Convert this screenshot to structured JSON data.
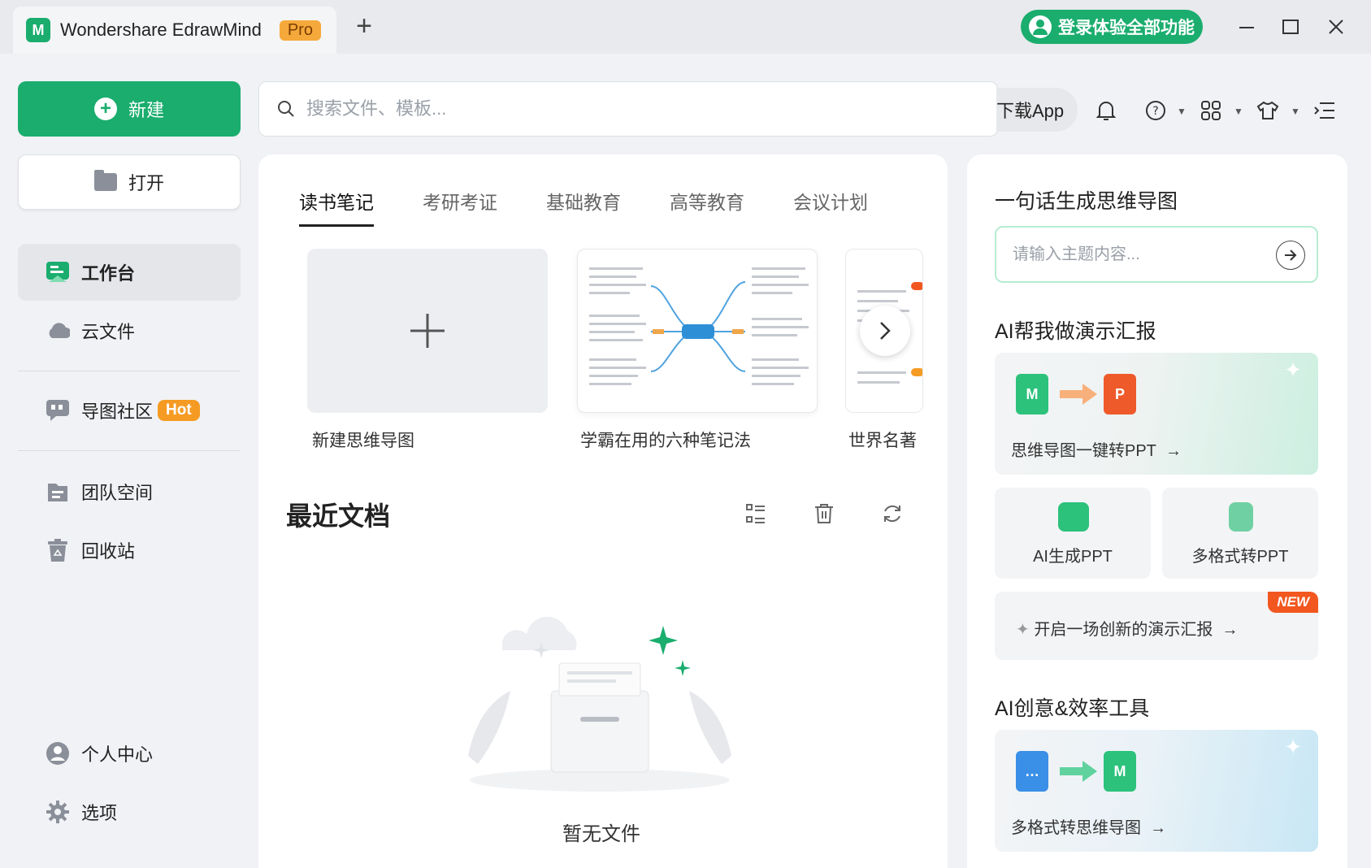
{
  "window": {
    "tab_title": "Wondershare EdrawMind",
    "pro_badge": "Pro",
    "new_tab": "+",
    "login_label": "登录体验全部功能",
    "minimize": "—",
    "maximize": "☐",
    "close": "✕"
  },
  "sidebar": {
    "new_label": "新建",
    "open_label": "打开",
    "nav": [
      {
        "label": "工作台"
      },
      {
        "label": "云文件"
      },
      {
        "label": "导图社区",
        "badge": "Hot"
      },
      {
        "label": "团队空间"
      },
      {
        "label": "回收站"
      }
    ],
    "bottom": [
      {
        "label": "个人中心"
      },
      {
        "label": "选项"
      }
    ]
  },
  "search": {
    "placeholder": "搜索文件、模板..."
  },
  "toolbar": {
    "download_app": "下载App"
  },
  "templates": {
    "tabs": [
      "读书笔记",
      "考研考证",
      "基础教育",
      "高等教育",
      "会议计划"
    ],
    "active_tab": "读书笔记",
    "cards": [
      {
        "label": "新建思维导图"
      },
      {
        "label": "学霸在用的六种笔记法"
      },
      {
        "label": "世界名著"
      }
    ]
  },
  "recent": {
    "title": "最近文档",
    "empty_text": "暂无文件"
  },
  "right_panel": {
    "ai_title": "一句话生成思维导图",
    "ai_placeholder": "请输入主题内容...",
    "present_title": "AI帮我做演示汇报",
    "mind_to_ppt": "思维导图一键转PPT",
    "ai_ppt": "AI生成PPT",
    "multi_ppt": "多格式转PPT",
    "promo_text": "开启一场创新的演示汇报",
    "new_badge": "NEW",
    "tools_title": "AI创意&效率工具",
    "multi_mind": "多格式转思维导图",
    "arrow": "→"
  },
  "colors": {
    "brand_green": "#1aad6e",
    "hot_orange": "#f59b23",
    "new_red": "#f2571f",
    "pro_orange": "#f6a93b"
  }
}
